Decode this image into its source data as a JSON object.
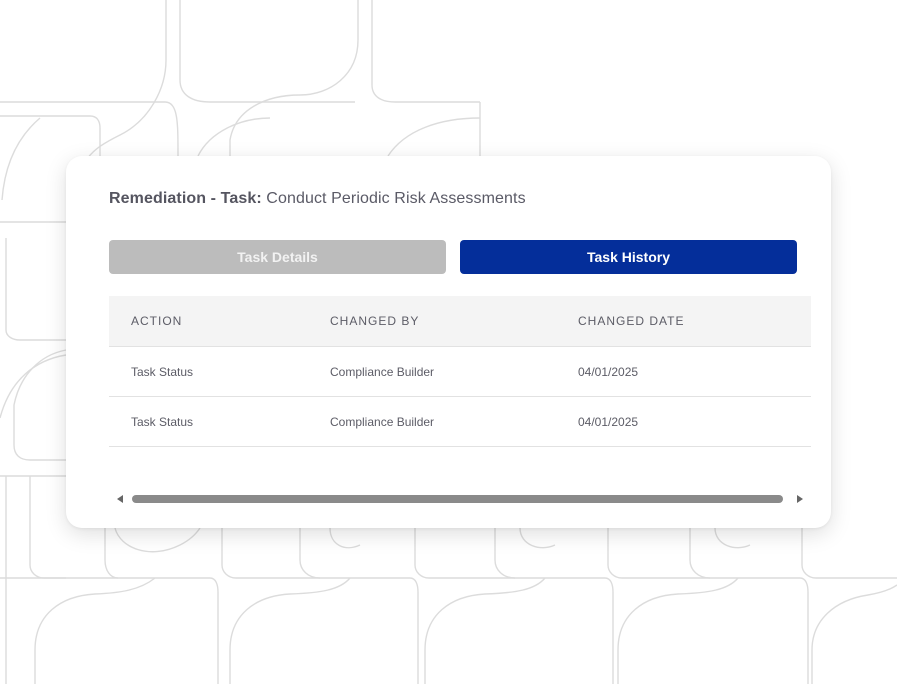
{
  "title": {
    "prefix": "Remediation - Task:",
    "name": "Conduct Periodic Risk Assessments"
  },
  "tabs": {
    "details": "Task Details",
    "history": "Task History",
    "active": "history"
  },
  "table": {
    "headers": [
      "ACTION",
      "CHANGED BY",
      "CHANGED DATE"
    ],
    "rows": [
      [
        "Task Status",
        "Compliance Builder",
        "04/01/2025"
      ],
      [
        "Task Status",
        "Compliance Builder",
        "04/01/2025"
      ]
    ]
  },
  "colors": {
    "active_tab": "#042e9a",
    "inactive_tab": "#bcbcbc",
    "pattern_stroke": "#dcdcdc"
  }
}
